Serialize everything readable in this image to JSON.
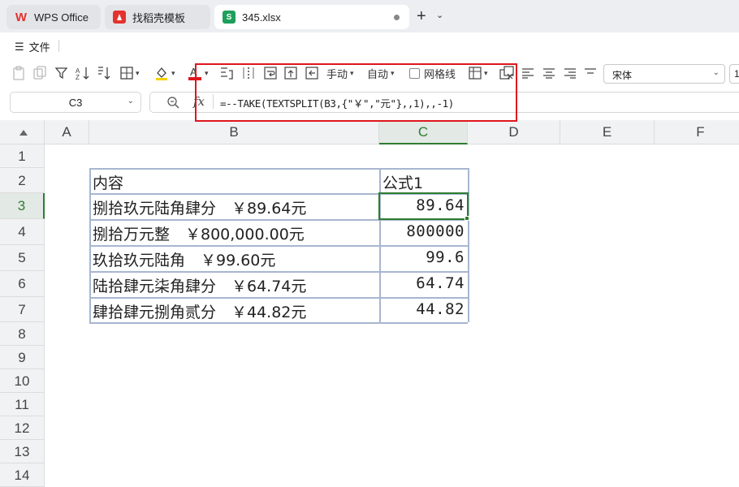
{
  "tabs": [
    {
      "label": "WPS Office",
      "icon": "wps-logo-icon"
    },
    {
      "label": "找稻壳模板",
      "icon": "docer-icon"
    },
    {
      "label": "345.xlsx",
      "icon": "spreadsheet-icon",
      "icon_letter": "S"
    }
  ],
  "menu": {
    "file_label": "文件"
  },
  "toolbar": {
    "row_height_label": "手动",
    "col_width_label": "自动",
    "gridlines_label": "网格线",
    "font_name": "宋体",
    "font_size": "1"
  },
  "formula_bar": {
    "cell_ref": "C3",
    "fx_label": "fx",
    "formula": "=--TAKE(TEXTSPLIT(B3,{\"￥\",\"元\"},,1),,-1)"
  },
  "columns": [
    "A",
    "B",
    "C",
    "D",
    "E",
    "F"
  ],
  "rows": [
    "1",
    "2",
    "3",
    "4",
    "5",
    "6",
    "7",
    "8",
    "9",
    "10",
    "11",
    "12",
    "13",
    "14"
  ],
  "active_cell": {
    "column": "C",
    "row": "3"
  },
  "table": {
    "header_b": "内容",
    "header_c": "公式1",
    "rows": [
      {
        "b": "捌拾玖元陆角肆分　￥89.64元",
        "c": "89.64"
      },
      {
        "b": "捌拾万元整　￥800,000.00元",
        "c": "800000"
      },
      {
        "b": "玖拾玖元陆角　￥99.60元",
        "c": "99.6"
      },
      {
        "b": "陆拾肆元柒角肆分　￥64.74元",
        "c": "64.74"
      },
      {
        "b": "肆拾肆元捌角贰分　￥44.82元",
        "c": "44.82"
      }
    ]
  },
  "colors": {
    "accent_green": "#2e7d32",
    "highlight_red": "#e0161d",
    "brand_red": "#e5322d"
  }
}
